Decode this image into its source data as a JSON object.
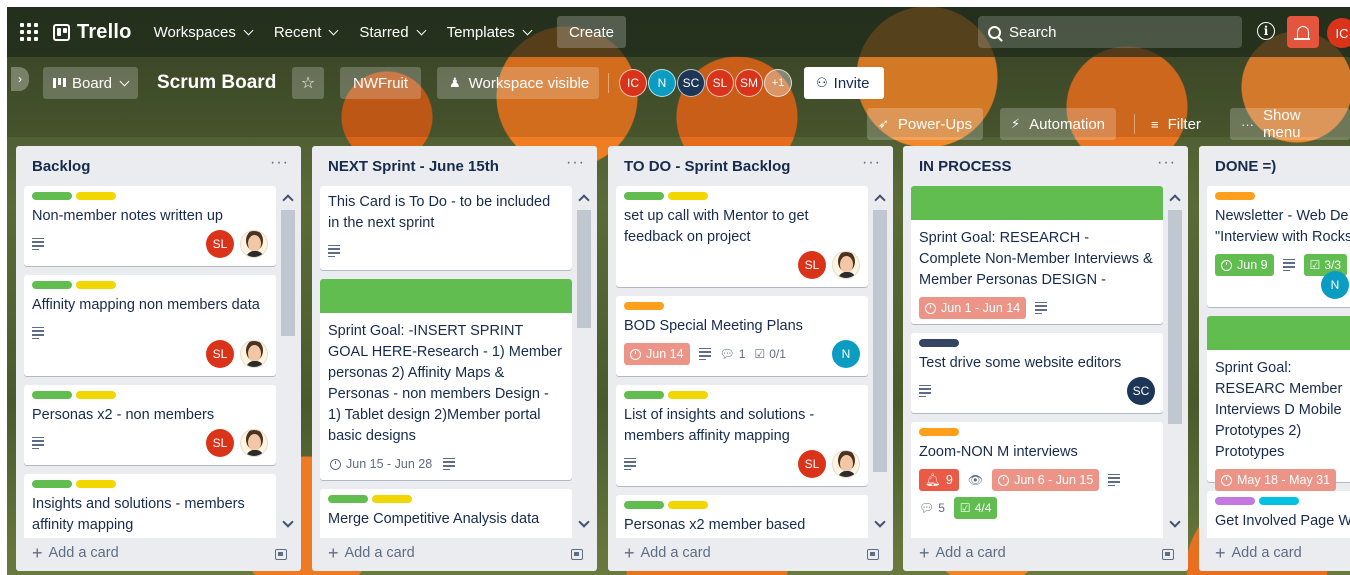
{
  "nav": {
    "brand": "Trello",
    "items": [
      "Workspaces",
      "Recent",
      "Starred",
      "Templates"
    ],
    "create": "Create",
    "search_placeholder": "Search",
    "user_initials": "IC"
  },
  "board": {
    "view": "Board",
    "title": "Scrum Board",
    "workspace": "NWFruit",
    "visibility": "Workspace visible",
    "members": [
      {
        "initials": "IC",
        "color": "#d9341a"
      },
      {
        "initials": "N",
        "color": "#0b9cc2"
      },
      {
        "initials": "SC",
        "color": "#1d3557"
      },
      {
        "initials": "SL",
        "color": "#d9341a"
      },
      {
        "initials": "SM",
        "color": "#d9341a"
      }
    ],
    "more_members": "+1",
    "invite": "Invite",
    "power_ups": "Power-Ups",
    "automation": "Automation",
    "filter": "Filter",
    "show_menu": "Show menu"
  },
  "colors": {
    "green": "#61bd4f",
    "yellow": "#f2d600",
    "orange": "#ff9f1a",
    "navy": "#344563",
    "purple": "#c377e0",
    "sky": "#00c2e0",
    "due_red": "#ec9488"
  },
  "add_card": "Add a card",
  "lists": [
    {
      "title": "Backlog",
      "cards": [
        {
          "labels": [
            "green",
            "yellow"
          ],
          "title": "Non-member notes written up",
          "members": [
            "SL",
            "face"
          ]
        },
        {
          "labels": [
            "green",
            "yellow"
          ],
          "title": "Affinity mapping non members data",
          "members": [
            "SL",
            "face"
          ]
        },
        {
          "labels": [
            "green",
            "yellow"
          ],
          "title": "Personas x2 - non members",
          "members": [
            "SL",
            "face"
          ]
        },
        {
          "labels": [
            "green",
            "yellow"
          ],
          "title": "Insights and solutions - members affinity mapping",
          "members": []
        }
      ]
    },
    {
      "title": "NEXT Sprint - June 15th",
      "cards": [
        {
          "labels": [],
          "title": "This Card is To Do - to be included in the next sprint",
          "members": []
        },
        {
          "cover": "green",
          "labels": [],
          "title": "Sprint Goal: -INSERT SPRINT GOAL HERE-Research - 1) Member personas 2) Affinity Maps & Personas - non members Design - 1) Tablet design 2)Member portal basic designs",
          "due": "Jun 15 - Jun 28",
          "members": []
        },
        {
          "labels": [
            "green",
            "yellow"
          ],
          "title": "Merge Competitive Analysis data",
          "members": []
        }
      ]
    },
    {
      "title": "TO DO - Sprint Backlog",
      "cards": [
        {
          "labels": [
            "green",
            "yellow"
          ],
          "title": "set up call with Mentor to get feedback on project",
          "members": [
            "SL",
            "face"
          ]
        },
        {
          "labels": [
            "orange"
          ],
          "title": "BOD Special Meeting Plans",
          "due": "Jun 14",
          "comments": "1",
          "checklist": "0/1",
          "members": [
            "N"
          ]
        },
        {
          "labels": [
            "green",
            "yellow"
          ],
          "title": "List of insights and solutions - members affinity mapping",
          "members": [
            "SL",
            "face"
          ]
        },
        {
          "labels": [
            "green",
            "yellow"
          ],
          "title": "Personas x2 member based",
          "members": []
        }
      ]
    },
    {
      "title": "IN PROCESS",
      "cards": [
        {
          "cover": "green",
          "labels": [],
          "title": "Sprint Goal: RESEARCH - Complete Non-Member Interviews & Member Personas DESIGN -",
          "due": "Jun 1 - Jun 14",
          "members": []
        },
        {
          "labels": [
            "navy"
          ],
          "title": "Test drive some website editors",
          "members": [
            "SC"
          ]
        },
        {
          "labels": [
            "orange"
          ],
          "title": "Zoom-NON M interviews",
          "notifications": "9",
          "due": "Jun 6 - Jun 15",
          "comments": "5",
          "checklist": "4/4",
          "members": []
        }
      ]
    },
    {
      "title": "DONE =)",
      "cards": [
        {
          "labels": [
            "orange"
          ],
          "title": "Newsletter - Web De \"Interview with Rocks",
          "due": "Jun 9",
          "checklist": "3/3",
          "members": [
            "N"
          ]
        },
        {
          "cover": "green",
          "labels": [],
          "title": "Sprint Goal: RESEARC Member Interviews D Mobile Prototypes 2) Prototypes",
          "due": "May 18 - May 31",
          "members": []
        },
        {
          "labels": [
            "purple",
            "sky"
          ],
          "title": "Get Involved Page W",
          "members": []
        }
      ]
    }
  ]
}
